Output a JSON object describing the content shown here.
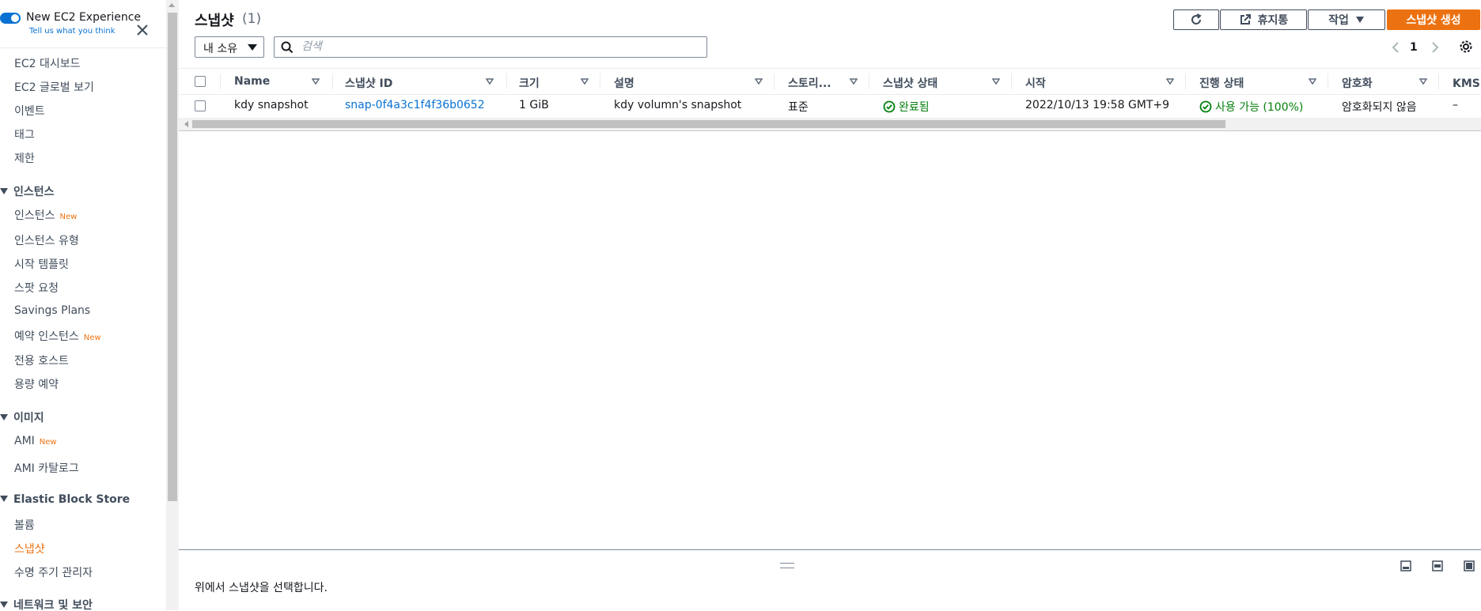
{
  "sidebar": {
    "experience_title": "New EC2 Experience",
    "experience_link": "Tell us what you think",
    "items": [
      {
        "label": "EC2 대시보드"
      },
      {
        "label": "EC2 글로벌 보기"
      },
      {
        "label": "이벤트"
      },
      {
        "label": "태그"
      },
      {
        "label": "제한"
      }
    ],
    "sections": [
      {
        "title": "인스턴스",
        "items": [
          {
            "label": "인스턴스",
            "badge": "New"
          },
          {
            "label": "인스턴스 유형"
          },
          {
            "label": "시작 템플릿"
          },
          {
            "label": "스팟 요청"
          },
          {
            "label": "Savings Plans"
          },
          {
            "label": "예약 인스턴스",
            "badge": "New"
          },
          {
            "label": "전용 호스트"
          },
          {
            "label": "용량 예약"
          }
        ]
      },
      {
        "title": "이미지",
        "items": [
          {
            "label": "AMI",
            "badge": "New"
          },
          {
            "label": "AMI 카탈로그"
          }
        ]
      },
      {
        "title": "Elastic Block Store",
        "items": [
          {
            "label": "볼륨"
          },
          {
            "label": "스냅샷",
            "active": true
          },
          {
            "label": "수명 주기 관리자"
          }
        ]
      },
      {
        "title": "네트워크 및 보안",
        "items": []
      }
    ]
  },
  "header": {
    "title": "스냅샷",
    "count": "(1)",
    "refresh_icon": "refresh-icon",
    "recycle_label": "휴지통",
    "actions_label": "작업",
    "create_label": "스냅샷 생성"
  },
  "filters": {
    "owner_value": "내 소유",
    "search_placeholder": "검색"
  },
  "pager": {
    "current_page": "1"
  },
  "table": {
    "columns": [
      "Name",
      "스냅샷 ID",
      "크기",
      "설명",
      "스토리...",
      "스냅샷 상태",
      "시작",
      "진행 상태",
      "암호화",
      "KMS 키"
    ],
    "rows": [
      {
        "name": "kdy snapshot",
        "snapshot_id": "snap-0f4a3c1f4f36b0652",
        "size": "1 GiB",
        "description": "kdy volumn's snapshot",
        "storage": "표준",
        "state": "완료됨",
        "started": "2022/10/13 19:58 GMT+9",
        "progress": "사용 가능 (100%)",
        "encryption": "암호화되지 않음",
        "kms": "–"
      }
    ]
  },
  "split_panel": {
    "message": "위에서 스냅샷을 선택합니다."
  },
  "colors": {
    "accent": "#ec7211",
    "link": "#0972d3",
    "success": "#037f0c"
  }
}
